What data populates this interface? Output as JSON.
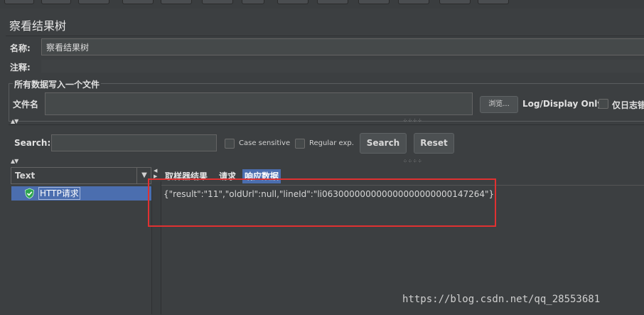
{
  "panel": {
    "title": "察看结果树",
    "name_label": "名称:",
    "name_value": "察看结果树",
    "comment_label": "注释:"
  },
  "file_section": {
    "legend": "所有数据写入一个文件",
    "filename_label": "文件名",
    "filename_value": "",
    "browse_label": "浏览...",
    "log_display_label": "Log/Display Only:",
    "errors_only_label": "仅日志错"
  },
  "search": {
    "label": "Search:",
    "value": "",
    "case_sensitive_label": "Case sensitive",
    "regular_exp_label": "Regular exp.",
    "search_button": "Search",
    "reset_button": "Reset"
  },
  "renderer": {
    "selected": "Text"
  },
  "tree": {
    "items": [
      {
        "label": "HTTP请求",
        "status": "success"
      }
    ]
  },
  "tabs": [
    {
      "label": "取样器结果"
    },
    {
      "label": "请求"
    },
    {
      "label": "响应数据",
      "active": true
    }
  ],
  "response": {
    "body": "{\"result\":\"11\",\"oldUrl\":null,\"lineId\":\"li063000000000000000000000147264\"}"
  },
  "watermark": "https://blog.csdn.net/qq_28553681",
  "colors": {
    "background": "#3c3f41",
    "selection": "#4b6eaf",
    "success_shield": "#2ea44f",
    "highlight_box": "#e03131"
  }
}
